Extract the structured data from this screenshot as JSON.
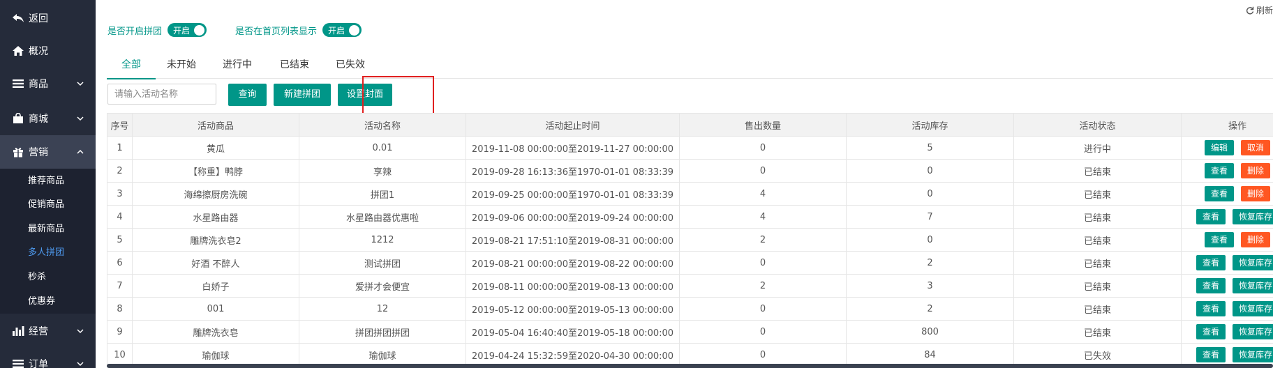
{
  "sidebar": {
    "items": [
      {
        "label": "返回",
        "icon": "back-arrow-icon"
      },
      {
        "label": "概况",
        "icon": "home-icon"
      },
      {
        "label": "商品",
        "icon": "list-icon"
      },
      {
        "label": "商城",
        "icon": "shopping-bag-icon"
      },
      {
        "label": "营销",
        "icon": "gift-icon"
      },
      {
        "label": "经营",
        "icon": "bar-chart-icon"
      },
      {
        "label": "订单",
        "icon": "list-icon"
      }
    ],
    "marketing_sub": [
      "推荐商品",
      "促销商品",
      "最新商品",
      "多人拼团",
      "秒杀",
      "优惠券"
    ]
  },
  "header": {
    "refresh_label": "刷新"
  },
  "settings": {
    "group_enable_label": "是否开启拼团",
    "group_enable_state": "开启",
    "show_home_label": "是否在首页列表显示",
    "show_home_state": "开启"
  },
  "tabs": [
    "全部",
    "未开始",
    "进行中",
    "已结束",
    "已失效"
  ],
  "search": {
    "placeholder": "请输入活动名称"
  },
  "buttons": {
    "query": "查询",
    "new_group": "新建拼团",
    "set_cover": "设置封面"
  },
  "table": {
    "columns": [
      "序号",
      "活动商品",
      "活动名称",
      "活动起止时间",
      "售出数量",
      "活动库存",
      "活动状态",
      "操作"
    ],
    "rows": [
      {
        "no": "1",
        "product": "黄瓜",
        "name": "0.01",
        "period": "2019-11-08 00:00:00至2019-11-27 00:00:00",
        "sold": "0",
        "stock": "5",
        "status": "进行中",
        "ops": [
          {
            "label": "编辑",
            "color": "teal"
          },
          {
            "label": "取消",
            "color": "orange"
          }
        ]
      },
      {
        "no": "2",
        "product": "【称重】鸭脖",
        "name": "享辣",
        "period": "2019-09-28 16:13:36至1970-01-01 08:33:39",
        "sold": "0",
        "stock": "0",
        "status": "已结束",
        "ops": [
          {
            "label": "查看",
            "color": "teal"
          },
          {
            "label": "删除",
            "color": "orange"
          }
        ]
      },
      {
        "no": "3",
        "product": "海绵擦厨房洗碗",
        "name": "拼团1",
        "period": "2019-09-25 00:00:00至1970-01-01 08:33:39",
        "sold": "4",
        "stock": "0",
        "status": "已结束",
        "ops": [
          {
            "label": "查看",
            "color": "teal"
          },
          {
            "label": "删除",
            "color": "orange"
          }
        ]
      },
      {
        "no": "4",
        "product": "水星路由器",
        "name": "水星路由器优惠啦",
        "period": "2019-09-06 00:00:00至2019-09-24 00:00:00",
        "sold": "4",
        "stock": "7",
        "status": "已结束",
        "ops": [
          {
            "label": "查看",
            "color": "teal"
          },
          {
            "label": "恢复库存",
            "color": "teal"
          }
        ]
      },
      {
        "no": "5",
        "product": "雕牌洗衣皂2",
        "name": "1212",
        "period": "2019-08-21 17:51:10至2019-08-31 00:00:00",
        "sold": "2",
        "stock": "0",
        "status": "已结束",
        "ops": [
          {
            "label": "查看",
            "color": "teal"
          },
          {
            "label": "删除",
            "color": "orange"
          }
        ]
      },
      {
        "no": "6",
        "product": "好酒 不醉人",
        "name": "测试拼团",
        "period": "2019-08-21 00:00:00至2019-08-22 00:00:00",
        "sold": "0",
        "stock": "2",
        "status": "已结束",
        "ops": [
          {
            "label": "查看",
            "color": "teal"
          },
          {
            "label": "恢复库存",
            "color": "teal"
          }
        ]
      },
      {
        "no": "7",
        "product": "白娇子",
        "name": "爱拼才会便宜",
        "period": "2019-08-11 00:00:00至2019-08-13 00:00:00",
        "sold": "2",
        "stock": "3",
        "status": "已结束",
        "ops": [
          {
            "label": "查看",
            "color": "teal"
          },
          {
            "label": "恢复库存",
            "color": "teal"
          }
        ]
      },
      {
        "no": "8",
        "product": "001",
        "name": "12",
        "period": "2019-05-12 00:00:00至2019-05-13 00:00:00",
        "sold": "0",
        "stock": "2",
        "status": "已结束",
        "ops": [
          {
            "label": "查看",
            "color": "teal"
          },
          {
            "label": "恢复库存",
            "color": "teal"
          }
        ]
      },
      {
        "no": "9",
        "product": "雕牌洗衣皂",
        "name": "拼团拼团拼团",
        "period": "2019-05-04 16:40:40至2019-05-18 00:00:00",
        "sold": "0",
        "stock": "800",
        "status": "已结束",
        "ops": [
          {
            "label": "查看",
            "color": "teal"
          },
          {
            "label": "恢复库存",
            "color": "teal"
          }
        ]
      },
      {
        "no": "10",
        "product": "瑜伽球",
        "name": "瑜伽球",
        "period": "2019-04-24 15:32:59至2020-04-30 00:00:00",
        "sold": "0",
        "stock": "84",
        "status": "已失效",
        "ops": [
          {
            "label": "查看",
            "color": "teal"
          },
          {
            "label": "恢复库存",
            "color": "teal"
          }
        ]
      }
    ]
  },
  "colors": {
    "accent": "#009688",
    "danger": "#ff5722",
    "sidebar_bg": "#252b3a",
    "highlight": "#e02020"
  }
}
